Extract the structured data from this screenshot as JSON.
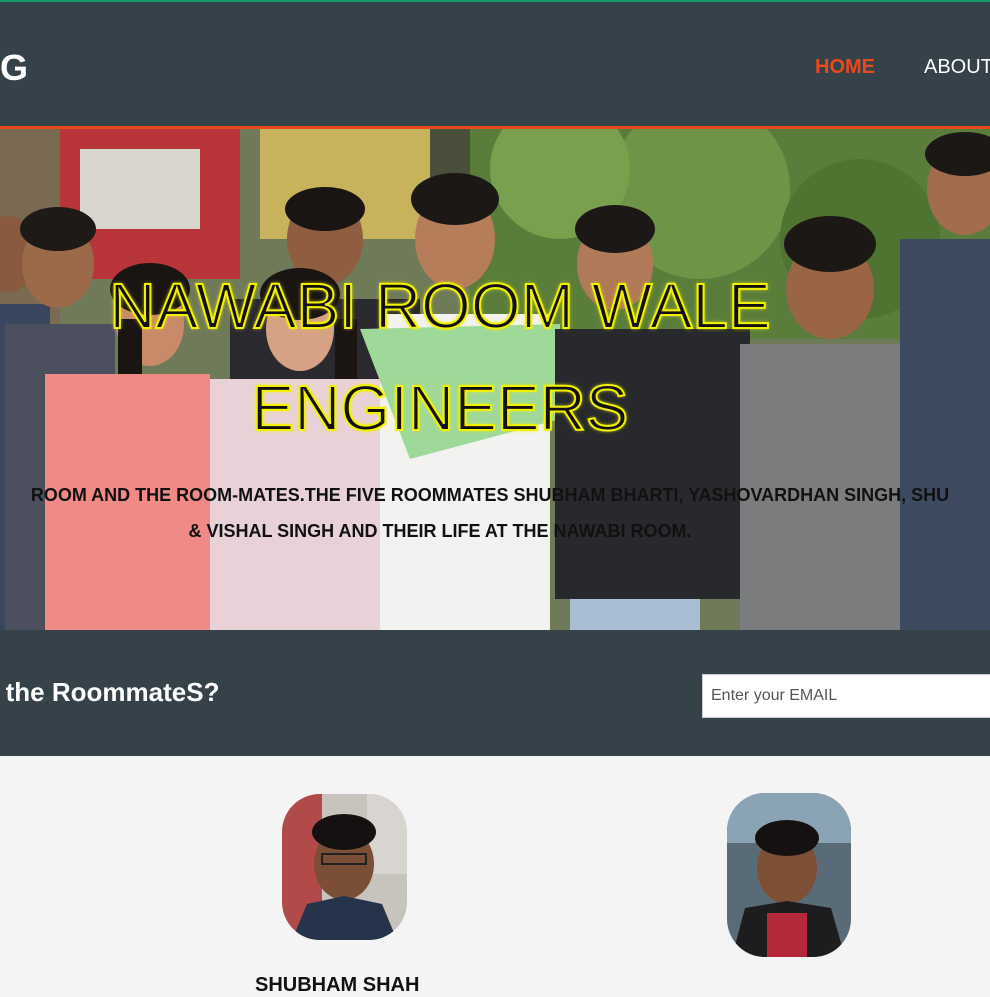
{
  "header": {
    "brand": "G",
    "nav": [
      {
        "label": "HOME",
        "active": true
      },
      {
        "label": "ABOUT",
        "active": false
      }
    ],
    "colors": {
      "bar": "#35424a",
      "accent": "#e8491d"
    }
  },
  "hero": {
    "title_line1": "NAWABI ROOM WALE",
    "title_line2": "ENGINEERS",
    "text_line1": "ROOM AND THE ROOM-MATES.THE FIVE ROOMMATES SHUBHAM BHARTI, YASHOVARDHAN SINGH, SHU",
    "text_line2": "& VISHAL SINGH AND THEIR LIFE AT THE NAWABI ROOM."
  },
  "newsletter": {
    "title": "out the RoommateS?",
    "email_placeholder": "Enter your EMAIL"
  },
  "team": {
    "members": [
      {
        "name": "SHUBHAM SHAH"
      },
      {
        "name": ""
      }
    ]
  }
}
